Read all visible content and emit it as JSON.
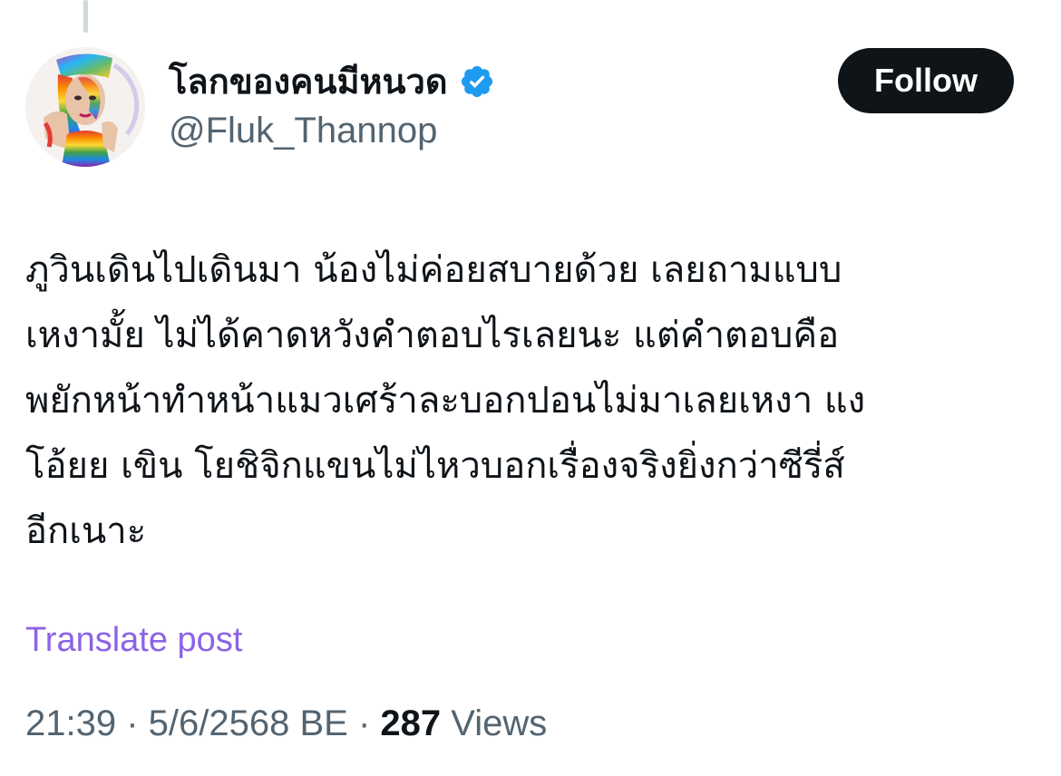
{
  "author": {
    "display_name": "โลกของคนมีหนวด",
    "handle": "@Fluk_Thannop",
    "verified": true,
    "avatar_icon": "profile-avatar-rainbow-portrait"
  },
  "follow_button": {
    "label": "Follow"
  },
  "post": {
    "lines": [
      "ภูวินเดินไปเดินมา น้องไม่ค่อยสบายด้วย เลยถามแบบ",
      "เหงามั้ย ไม่ได้คาดหวังคำตอบไรเลยนะ แต่คำตอบคือ",
      "พยักหน้าทำหน้าแมวเศร้าละบอกปอนไม่มาเลยเหงา แง",
      "โอ้ยย เขิน โยชิจิกแขนไม่ไหวบอกเรื่องจริงยิ่งกว่าซีรี่ส์",
      "อีกเนาะ"
    ]
  },
  "translate": {
    "label": "Translate post"
  },
  "meta": {
    "time": "21:39",
    "separator": " · ",
    "date": "5/6/2568 BE",
    "views_count": "287",
    "views_label": " Views"
  },
  "colors": {
    "text_primary": "#0f1419",
    "text_secondary": "#536471",
    "verified_blue": "#1d9bf0",
    "translate_link": "#8b63e6",
    "follow_bg": "#0f1419"
  }
}
